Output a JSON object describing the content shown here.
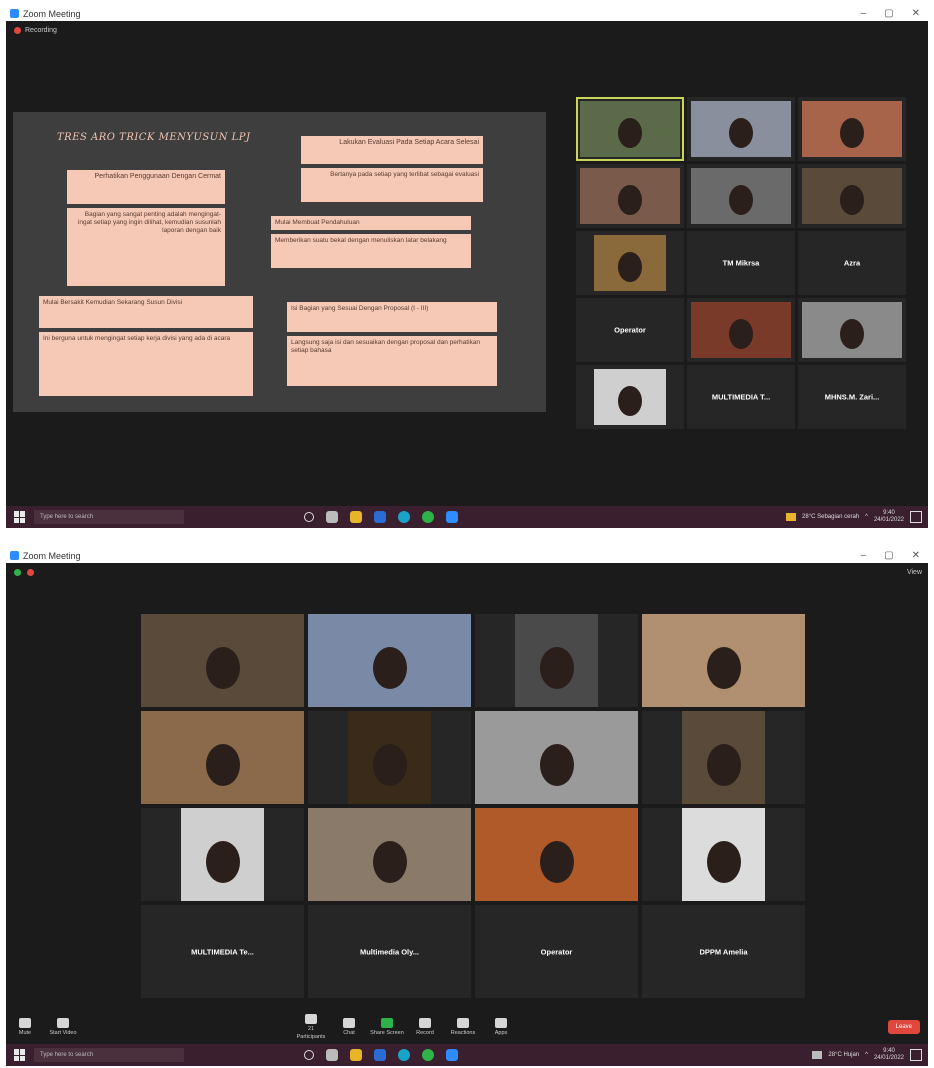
{
  "shot1": {
    "window_title": "Zoom Meeting",
    "recording_label": "Recording",
    "slide": {
      "title": "TRES ARO TRICK MENYUSUN LPJ",
      "boxes": [
        {
          "head": "Perhatikan Penggunaan Dengan Cermat",
          "body": "Bagian yang sangat penting adalah mengingat-ingat setiap yang ingin dilihat, kemudian susunlah laporan dengan baik"
        },
        {
          "head": "Mulai Membuat Pendahuluan",
          "body": "Memberikan suatu bekal dengan menuliskan latar belakang"
        },
        {
          "head": "Lakukan Evaluasi Pada Setiap Acara Selesai",
          "body": "Bertanya pada setiap yang terlibat sebagai evaluasi"
        },
        {
          "head": "Mulai Bersakit Kemudian Sekarang Susun Divisi",
          "body": "Ini berguna untuk mengingat setiap kerja divisi yang ada di acara"
        },
        {
          "head": "Isi Bagian yang Sesuai Dengan Proposal (I - III)",
          "body": "Langsung saja isi dan sesuaikan dengan proposal dan perhatikan setiap bahasa"
        }
      ]
    },
    "participants": [
      {
        "name": ""
      },
      {
        "name": ""
      },
      {
        "name": ""
      },
      {
        "name": ""
      },
      {
        "name": ""
      },
      {
        "name": ""
      },
      {
        "name": ""
      },
      {
        "name": "TM Mikrsa"
      },
      {
        "name": "Azra"
      },
      {
        "name": "Operator"
      },
      {
        "name": ""
      },
      {
        "name": ""
      },
      {
        "name": ""
      },
      {
        "name": "MULTIMEDIA T..."
      },
      {
        "name": "MHNS.M. Zari..."
      }
    ],
    "taskbar": {
      "search_placeholder": "Type here to search",
      "weather": "28°C Sebagian cerah",
      "time": "9:40",
      "date": "24/01/2022"
    }
  },
  "shot2": {
    "window_title": "Zoom Meeting",
    "view_label": "View",
    "tile_names": [
      "MULTIMEDIA Te...",
      "Multimedia Oly...",
      "Operator",
      "DPPM Amelia"
    ],
    "controls": [
      {
        "label": "Mute"
      },
      {
        "label": "Start Video"
      },
      {
        "label": "Participants",
        "count": "21"
      },
      {
        "label": "Chat"
      },
      {
        "label": "Share Screen"
      },
      {
        "label": "Record"
      },
      {
        "label": "Reactions"
      },
      {
        "label": "Apps"
      }
    ],
    "end_label": "Leave",
    "taskbar": {
      "search_placeholder": "Type here to search",
      "weather": "28°C Hujan",
      "time": "9:40",
      "date": "24/01/2022"
    }
  },
  "colors": {
    "zoom_bg": "#1b1b1b",
    "slide_bg": "#3e3e3e",
    "slide_box": "#f6c9b6",
    "active_speaker": "#c9d65a",
    "taskbar": "#3a1f2e",
    "leave": "#e0483e"
  }
}
